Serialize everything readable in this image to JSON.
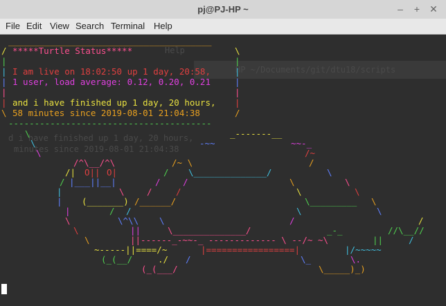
{
  "window": {
    "title": "pj@PJ-HP ~",
    "minimize": "–",
    "maximize": "+",
    "close": "✕"
  },
  "menu": {
    "file": "File",
    "edit": "Edit",
    "view": "View",
    "search": "Search",
    "terminal": "Terminal",
    "help": "Help"
  },
  "status": {
    "header": "*****Turtle Status*****",
    "line1": "I am live on 18:02:50 up 1 day, 20:58,",
    "line2": "1 user, load average: 0.12, 0.20, 0.21",
    "line3": "and i have finished up 1 day, 20 hours,",
    "line4": "58 minutes since 2019-08-01 21:04:38"
  },
  "ghost": {
    "help": "Help",
    "path": "HP ~/Documents/git/dtu18/scripts",
    "finished": "d i have finished up 1 day, 20 hours,",
    "since": "minutes since 2019-08-01 21:04:38"
  },
  "colors": {
    "terminal_bg": "#2e2e2e",
    "titlebar_bg": "#d6d6d6",
    "menubar_bg": "#e8e8e8"
  }
}
